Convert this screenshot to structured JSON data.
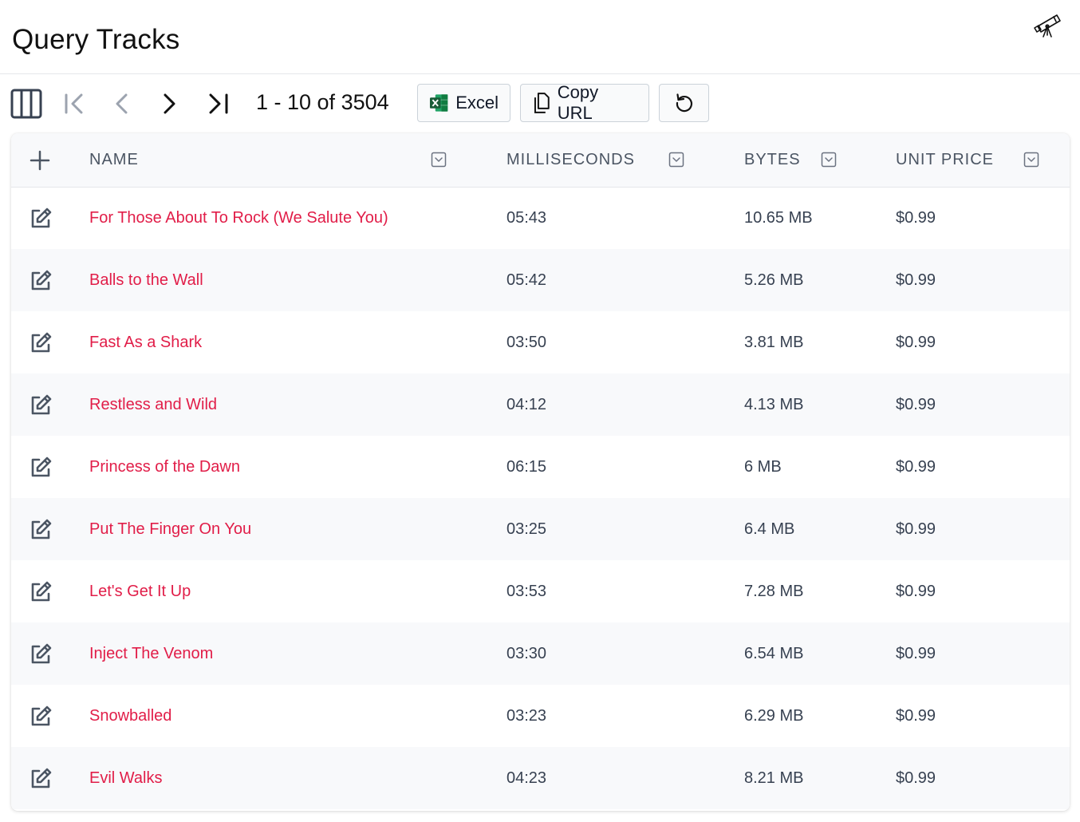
{
  "page": {
    "title": "Query Tracks"
  },
  "icons": {
    "explorer": "telescope-icon",
    "columns": "columns-icon",
    "first": "first-page-icon",
    "prev": "chevron-left-icon",
    "next": "chevron-right-icon",
    "last": "last-page-icon",
    "excel": "excel-icon",
    "copy": "copy-icon",
    "reset": "reset-icon",
    "add": "plus-icon",
    "edit": "edit-icon",
    "sort": "sort-dropdown-icon"
  },
  "toolbar": {
    "paging": "1 - 10 of 3504",
    "excel_label": "Excel",
    "copy_url_label": "Copy URL"
  },
  "colors": {
    "link": "#e11d48",
    "header_bg": "#f8f9fb",
    "excel_green": "#1d6f42"
  },
  "table": {
    "columns": [
      {
        "label": "NAME"
      },
      {
        "label": "MILLISECONDS"
      },
      {
        "label": "BYTES"
      },
      {
        "label": "UNIT PRICE"
      }
    ],
    "rows": [
      {
        "name": "For Those About To Rock (We Salute You)",
        "ms": "05:43",
        "bytes": "10.65 MB",
        "price": "$0.99"
      },
      {
        "name": "Balls to the Wall",
        "ms": "05:42",
        "bytes": "5.26 MB",
        "price": "$0.99"
      },
      {
        "name": "Fast As a Shark",
        "ms": "03:50",
        "bytes": "3.81 MB",
        "price": "$0.99"
      },
      {
        "name": "Restless and Wild",
        "ms": "04:12",
        "bytes": "4.13 MB",
        "price": "$0.99"
      },
      {
        "name": "Princess of the Dawn",
        "ms": "06:15",
        "bytes": "6 MB",
        "price": "$0.99"
      },
      {
        "name": "Put The Finger On You",
        "ms": "03:25",
        "bytes": "6.4 MB",
        "price": "$0.99"
      },
      {
        "name": "Let's Get It Up",
        "ms": "03:53",
        "bytes": "7.28 MB",
        "price": "$0.99"
      },
      {
        "name": "Inject The Venom",
        "ms": "03:30",
        "bytes": "6.54 MB",
        "price": "$0.99"
      },
      {
        "name": "Snowballed",
        "ms": "03:23",
        "bytes": "6.29 MB",
        "price": "$0.99"
      },
      {
        "name": "Evil Walks",
        "ms": "04:23",
        "bytes": "8.21 MB",
        "price": "$0.99"
      }
    ]
  }
}
